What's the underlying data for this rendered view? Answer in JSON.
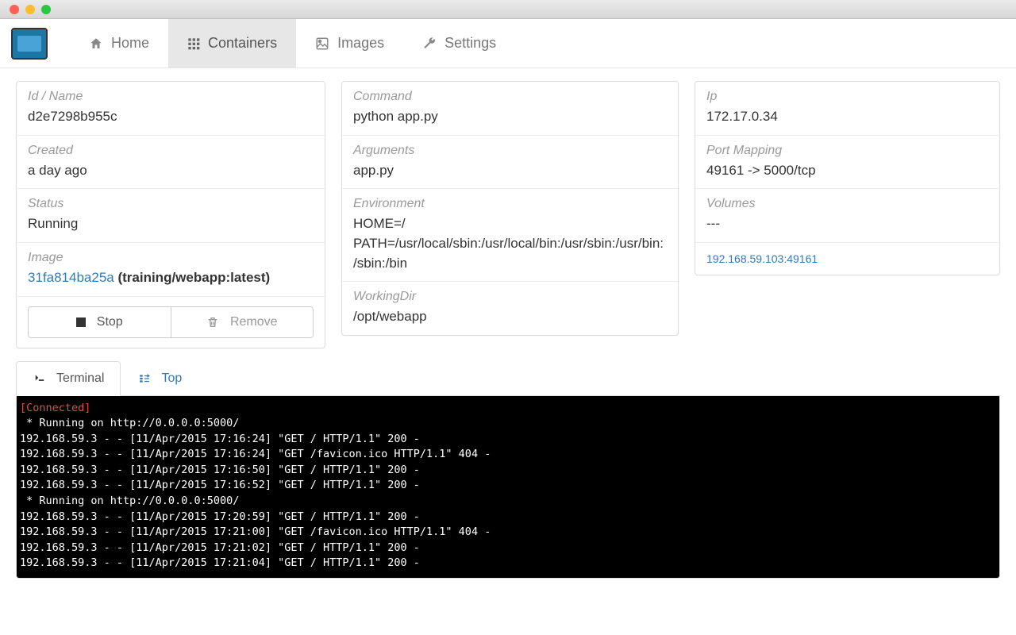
{
  "nav": {
    "home": "Home",
    "containers": "Containers",
    "images": "Images",
    "settings": "Settings"
  },
  "col1": {
    "idname_label": "Id / Name",
    "idname_value": "d2e7298b955c",
    "created_label": "Created",
    "created_value": "a day ago",
    "status_label": "Status",
    "status_value": "Running",
    "image_label": "Image",
    "image_link": "31fa814ba25a",
    "image_rest": " (training/webapp:latest)",
    "stop_btn": "Stop",
    "remove_btn": "Remove"
  },
  "col2": {
    "command_label": "Command",
    "command_value": "python app.py",
    "args_label": "Arguments",
    "args_value": "app.py",
    "env_label": "Environment",
    "env_value": "HOME=/\nPATH=/usr/local/sbin:/usr/local/bin:/usr/sbin:/usr/bin:/sbin:/bin",
    "wd_label": "WorkingDir",
    "wd_value": "/opt/webapp"
  },
  "col3": {
    "ip_label": "Ip",
    "ip_value": "172.17.0.34",
    "port_label": "Port Mapping",
    "port_value": "49161 -> 5000/tcp",
    "vol_label": "Volumes",
    "vol_value": "---",
    "external_link": "192.168.59.103:49161"
  },
  "tabs": {
    "terminal": "Terminal",
    "top": "Top"
  },
  "terminal": {
    "connected": "[Connected]",
    "lines": " * Running on http://0.0.0.0:5000/\n192.168.59.3 - - [11/Apr/2015 17:16:24] \"GET / HTTP/1.1\" 200 -\n192.168.59.3 - - [11/Apr/2015 17:16:24] \"GET /favicon.ico HTTP/1.1\" 404 -\n192.168.59.3 - - [11/Apr/2015 17:16:50] \"GET / HTTP/1.1\" 200 -\n192.168.59.3 - - [11/Apr/2015 17:16:52] \"GET / HTTP/1.1\" 200 -\n * Running on http://0.0.0.0:5000/\n192.168.59.3 - - [11/Apr/2015 17:20:59] \"GET / HTTP/1.1\" 200 -\n192.168.59.3 - - [11/Apr/2015 17:21:00] \"GET /favicon.ico HTTP/1.1\" 404 -\n192.168.59.3 - - [11/Apr/2015 17:21:02] \"GET / HTTP/1.1\" 200 -\n192.168.59.3 - - [11/Apr/2015 17:21:04] \"GET / HTTP/1.1\" 200 -"
  }
}
